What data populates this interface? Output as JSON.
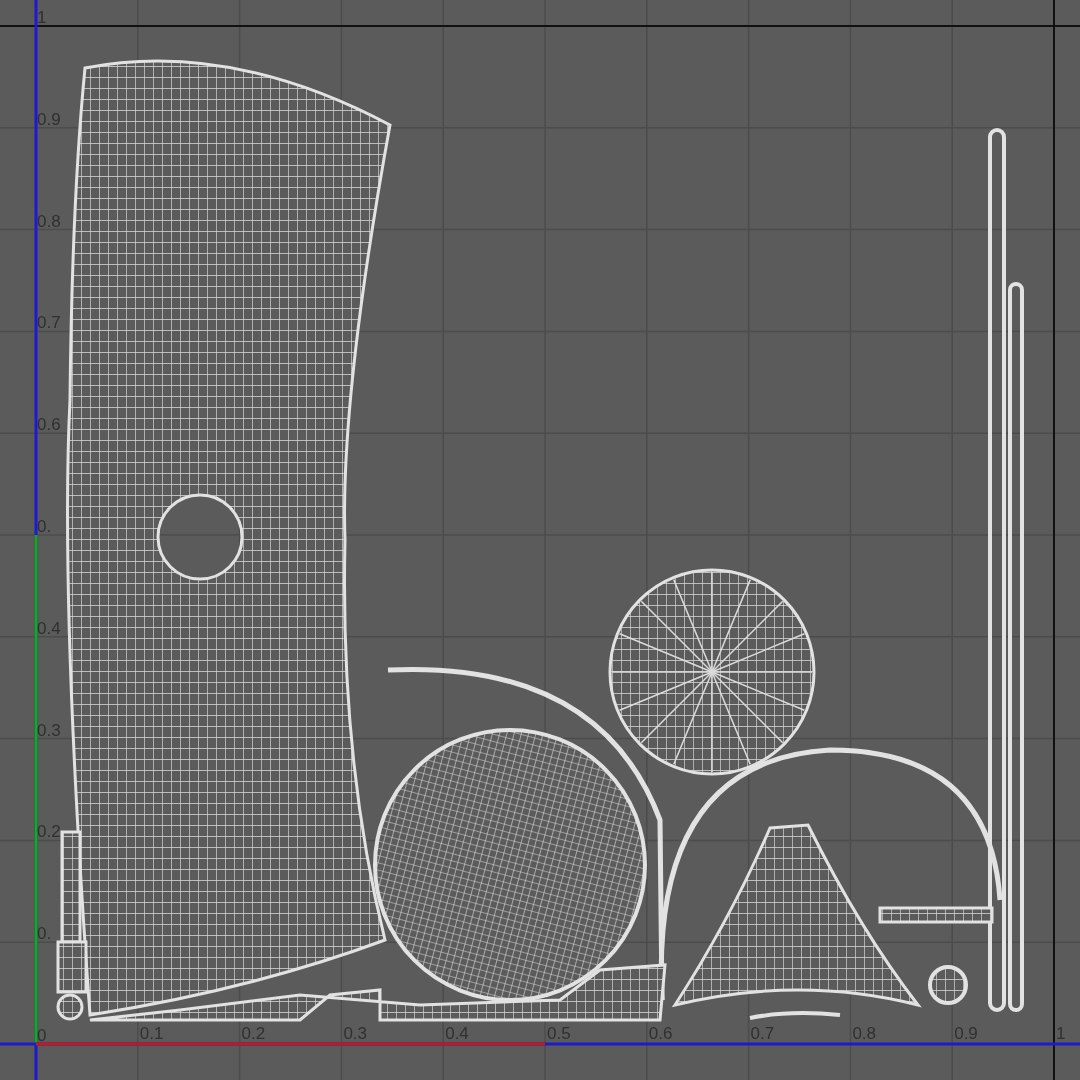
{
  "uv_editor": {
    "v_axis_labels": [
      "1",
      "0.9",
      "0.8",
      "0.7",
      "0.6",
      "0.",
      "0.4",
      "0.3",
      "0.2",
      "0.",
      "0"
    ],
    "u_axis_labels": [
      "0.1",
      "0.2",
      "0.3",
      "0.4",
      "0.5",
      "0.6",
      "0.7",
      "0.8",
      "0.9",
      "1"
    ]
  }
}
